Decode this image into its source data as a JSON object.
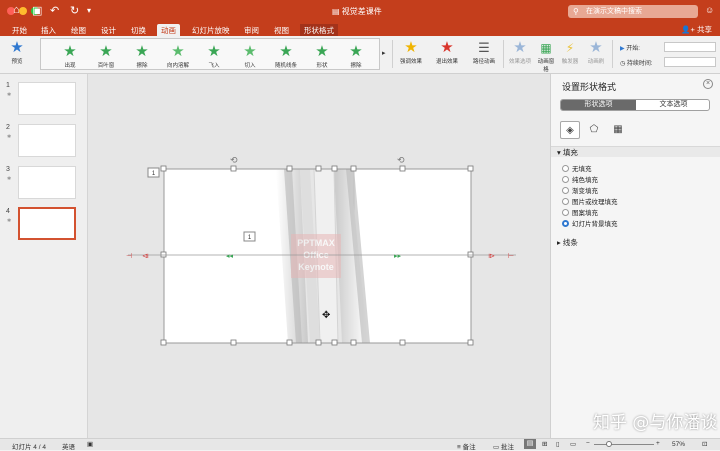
{
  "window": {
    "document_title": "视觉差课件",
    "search_placeholder": "在演示文稿中搜索",
    "share_label": "共享"
  },
  "ribbon_tabs": [
    {
      "label": "开始"
    },
    {
      "label": "插入"
    },
    {
      "label": "绘图"
    },
    {
      "label": "设计"
    },
    {
      "label": "切换"
    },
    {
      "label": "动画",
      "active": true
    },
    {
      "label": "幻灯片放映"
    },
    {
      "label": "审阅"
    },
    {
      "label": "视图"
    },
    {
      "label": "形状格式",
      "contextual": true
    }
  ],
  "ribbon": {
    "preview_label": "预览",
    "effects": [
      {
        "label": "出现",
        "color": "#3aa655"
      },
      {
        "label": "百叶窗",
        "color": "#3aa655"
      },
      {
        "label": "擦除",
        "color": "#3aa655"
      },
      {
        "label": "向内溶解",
        "color": "#3aa655"
      },
      {
        "label": "飞入",
        "color": "#3aa655"
      },
      {
        "label": "切入",
        "color": "#3aa655"
      },
      {
        "label": "随机线条",
        "color": "#3aa655"
      },
      {
        "label": "形状",
        "color": "#3aa655"
      },
      {
        "label": "擦除",
        "color": "#3aa655"
      }
    ],
    "emphasis_label": "强调效果",
    "exit_label": "退出效果",
    "path_label": "路径动画",
    "effect_options_label": "效果选项",
    "animation_pane_label": "动画窗格",
    "trigger_label": "触发器",
    "reorder_label": "动画刷",
    "start_label": "开始:",
    "duration_label": "持续时间:"
  },
  "slides": [
    {
      "number": "1"
    },
    {
      "number": "2"
    },
    {
      "number": "3"
    },
    {
      "number": "4",
      "selected": true
    }
  ],
  "canvas": {
    "left_label": "1",
    "center_label": "1",
    "faded_text_lines": [
      "PPTMAX",
      "Office",
      "Keynote"
    ]
  },
  "format_pane": {
    "title": "设置形状格式",
    "tab_shape": "形状选项",
    "tab_text": "文本选项",
    "fill_header": "填充",
    "options": [
      {
        "label": "无填充",
        "selected": false
      },
      {
        "label": "纯色填充",
        "selected": false
      },
      {
        "label": "渐变填充",
        "selected": false
      },
      {
        "label": "图片或纹理填充",
        "selected": false
      },
      {
        "label": "图案填充",
        "selected": false
      },
      {
        "label": "幻灯片背景填充",
        "selected": true
      }
    ],
    "line_header": "线条"
  },
  "status": {
    "slide_info": "幻灯片 4 / 4",
    "language": "英语",
    "notes_label": "备注",
    "comments_label": "批注",
    "zoom": "57%"
  },
  "watermark": "知乎 @与你潘谈"
}
